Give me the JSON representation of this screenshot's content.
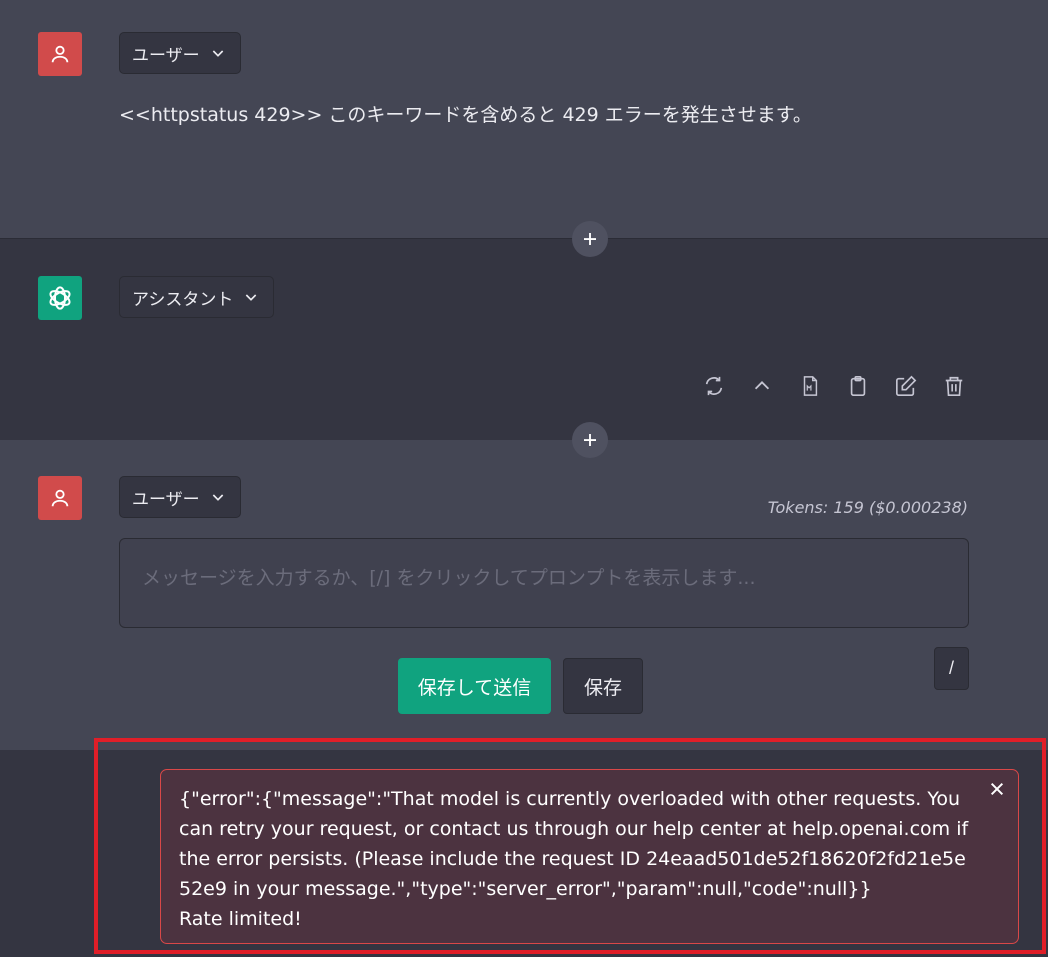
{
  "messages": [
    {
      "role_label": "ユーザー",
      "avatar_icon": "user-icon",
      "text": "<<httpstatus 429>> このキーワードを含めると 429 エラーを発生させます。"
    },
    {
      "role_label": "アシスタント",
      "avatar_icon": "openai-logo-icon",
      "text": ""
    }
  ],
  "toolbar": {
    "icons": [
      "refresh-icon",
      "chevron-up-icon",
      "markdown-file-icon",
      "clipboard-icon",
      "edit-icon",
      "trash-icon"
    ]
  },
  "composer": {
    "role_label": "ユーザー",
    "tokens": "Tokens: 159 ($0.000238)",
    "placeholder": "メッセージを入力するか、[/] をクリックしてプロンプトを表示します...",
    "save_submit_label": "保存して送信",
    "save_label": "保存",
    "slash_label": "/"
  },
  "error": {
    "message": "{\"error\":{\"message\":\"That model is currently overloaded with other requests. You can retry your request, or contact us through our help center at help.openai.com if the error persists. (Please include the request ID 24eaad501de52f18620f2fd21e5e52e9 in your message.\",\"type\":\"server_error\",\"param\":null,\"code\":null}}",
    "status": "Rate limited!"
  },
  "colors": {
    "accent": "#10a37f",
    "user_avatar": "#d14b4b",
    "error_border": "#d94848",
    "highlight": "#e01e28"
  }
}
